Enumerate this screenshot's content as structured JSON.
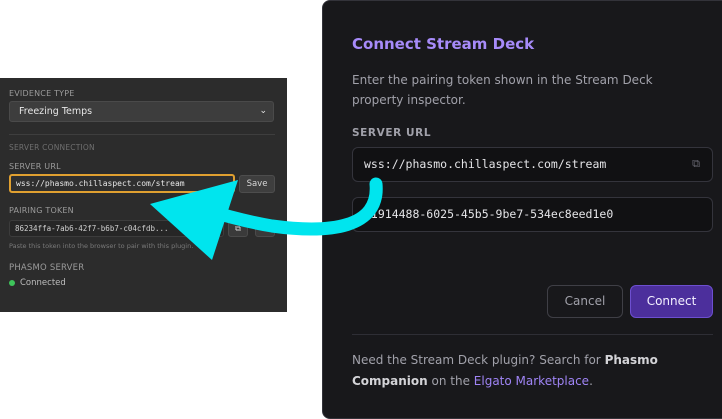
{
  "property_inspector": {
    "evidence_type_label": "EVIDENCE TYPE",
    "evidence_type_value": "Freezing Temps",
    "server_connection_label": "SERVER CONNECTION",
    "server_url_label": "SERVER URL",
    "server_url_value": "wss://phasmo.chillaspect.com/stream",
    "save_label": "Save",
    "pairing_token_label": "PAIRING TOKEN",
    "pairing_token_value": "86234ffa-7ab6-42f7-b6b7-c04cfdb...",
    "pairing_hint": "Paste this token into the browser to pair with this plugin.",
    "phasmo_server_label": "PHASMO SERVER",
    "phasmo_server_status": "Connected"
  },
  "dialog": {
    "title": "Connect Stream Deck",
    "description": "Enter the pairing token shown in the Stream Deck property inspector.",
    "server_url_label": "SERVER URL",
    "server_url_value": "wss://phasmo.chillaspect.com/stream",
    "token_value": "61914488-6025-45b5-9be7-534ec8eed1e0",
    "cancel_label": "Cancel",
    "connect_label": "Connect",
    "footer": {
      "prefix": "Need the Stream Deck plugin? Search for ",
      "bold1": "Phasmo",
      "bold2": "Companion",
      "middle": " on the ",
      "link": "Elgato Marketplace",
      "suffix": "."
    }
  },
  "colors": {
    "accent": "#a78bfa",
    "connect_button": "#4c2f9c",
    "arrow": "#00e5ee",
    "status_ok": "#3ec45a",
    "highlight_border": "#e0a030"
  }
}
